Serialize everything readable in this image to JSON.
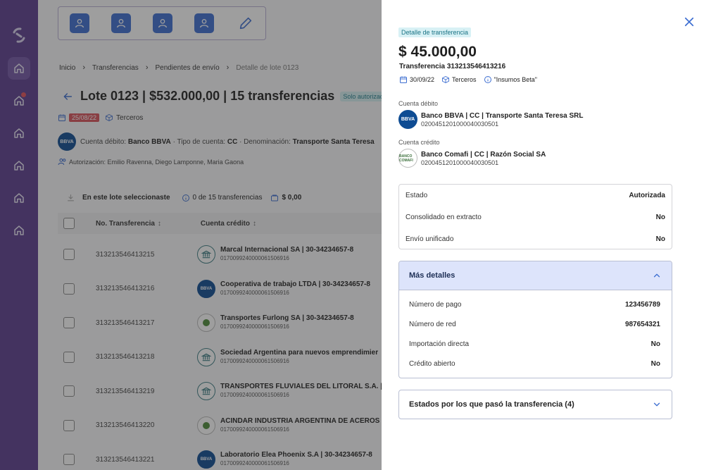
{
  "sidebar": {
    "items": [
      {
        "icon": "home-icon",
        "active": true
      },
      {
        "icon": "home-icon",
        "notification": true
      },
      {
        "icon": "home-icon"
      },
      {
        "icon": "home-icon"
      },
      {
        "icon": "home-icon"
      },
      {
        "icon": "home-icon"
      }
    ]
  },
  "toolbar": {
    "buttons": [
      "user-icon",
      "user-icon",
      "user-icon",
      "user-icon"
    ],
    "edit_icon": "pencil-icon"
  },
  "breadcrumb": {
    "items": [
      "Inicio",
      "Transferencias",
      "Pendientes de envío"
    ],
    "current": "Detalle de lote 0123"
  },
  "lote": {
    "title": "Lote 0123 | $532.000,00 | 15 transferencias",
    "badge": "Solo autorizadas",
    "date": "25/08/22",
    "tipo": "Terceros",
    "cuenta_prefix": "Cuenta débito:",
    "cuenta_bank": "Banco BBVA",
    "tipo_cuenta_prefix": "· Tipo de cuenta:",
    "tipo_cuenta": "CC",
    "denominacion_prefix": "· Denominación:",
    "denominacion": "Transporte Santa Teresa",
    "bank_logo": "BBVA",
    "autorizacion": "Autorización: Emilio Ravenna, Diego Lamponne, Maria Gaona"
  },
  "selection": {
    "label": "En este lote seleccionaste",
    "count": "0 de 15 transferencias",
    "amount": "$ 0,00"
  },
  "table": {
    "columns": [
      "No. Transferencia",
      "Cuenta crédito"
    ],
    "rows": [
      {
        "num": "313213546413215",
        "name": "Marcal Internacional SA | 30-34234657-8",
        "cbu": "0170099240000061506916",
        "logo": "bank"
      },
      {
        "num": "313213546413216",
        "name": "Cooperativa de trabajo LTDA | 30-34234657-8",
        "cbu": "0170099240000061506916",
        "logo": "BBVA"
      },
      {
        "num": "313213546413217",
        "name": "Transportes Furlong SA | 30-34234657-8",
        "cbu": "0170099240000061506916",
        "logo": "comafi"
      },
      {
        "num": "313213546413218",
        "name": "Sociedad Argentina para nuevos emprendimier",
        "cbu": "0170099240000061506916",
        "logo": "bank"
      },
      {
        "num": "313213546413219",
        "name": "TRANSPORTES FLUVIALES DEL LITORAL S.A. |",
        "cbu": "0170099240000061506916",
        "logo": "bank"
      },
      {
        "num": "313213546413220",
        "name": "ACINDAR INDUSTRIA ARGENTINA DE ACEROS |",
        "cbu": "0170099240000061506916",
        "logo": "comafi"
      },
      {
        "num": "313213546413221",
        "name": "Laboratorio Elea Phoenix S.A | 30-34234657-8",
        "cbu": "0170099240000061506916",
        "logo": "BBVA"
      }
    ]
  },
  "drawer": {
    "chip": "Detalle de transferencia",
    "amount": "$ 45.000,00",
    "transfer_no": "Transferencia 313213546413216",
    "date": "30/09/22",
    "tipo": "Terceros",
    "ref": "\"Insumos Beta\"",
    "debito": {
      "label": "Cuenta débito",
      "logo": "BBVA",
      "name": "Banco BBVA |  CC | Transporte Santa Teresa SRL",
      "cbu": "0200451201000040030501"
    },
    "credito": {
      "label": "Cuenta crédito",
      "logo": "BANCO COMAFI",
      "name": "Banco Comafi  |  CC | Razón Social SA",
      "cbu": "0200451201000040030501"
    },
    "estado": [
      {
        "k": "Estado",
        "v": "Autorizada"
      },
      {
        "k": "Consolidado en extracto",
        "v": "No"
      },
      {
        "k": "Envío unificado",
        "v": "No"
      }
    ],
    "mas_detalles": {
      "title": "Más detalles",
      "rows": [
        {
          "k": "Número de pago",
          "v": "123456789"
        },
        {
          "k": "Número de red",
          "v": "987654321"
        },
        {
          "k": "Importación directa",
          "v": "No"
        },
        {
          "k": "Crédito abierto",
          "v": "No"
        }
      ]
    },
    "estados_title": "Estados por los que pasó la transferencia (4)"
  },
  "colors": {
    "sidebar": "#5b3c8e",
    "accent": "#3d6ed1",
    "danger": "#d9505a",
    "teal": "#1a7385"
  }
}
